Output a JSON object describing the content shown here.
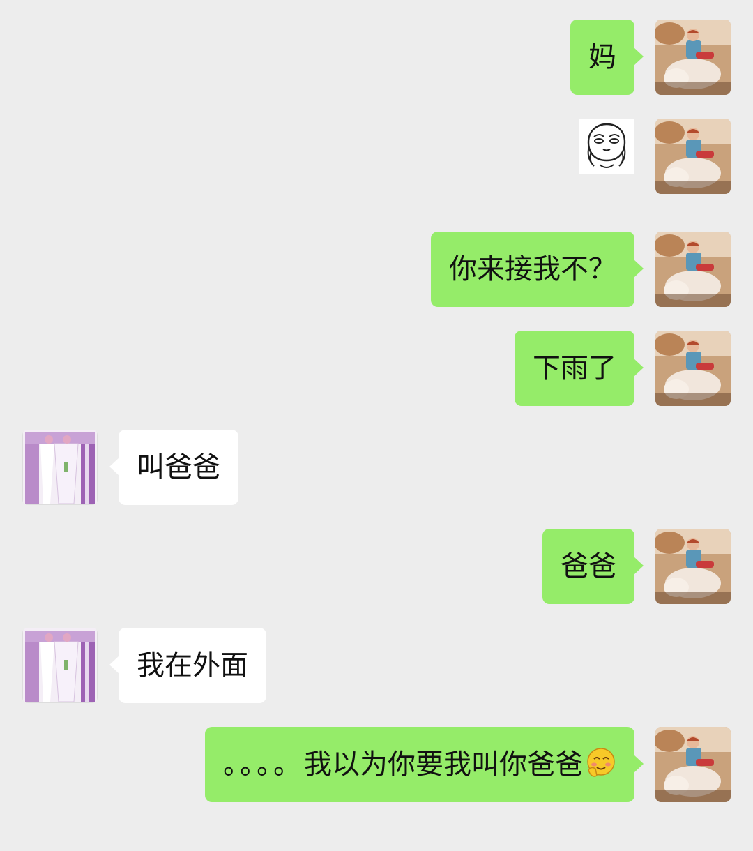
{
  "chat": {
    "messages": [
      {
        "id": "m1",
        "sender": "me",
        "text": "妈"
      },
      {
        "id": "m2",
        "sender": "me",
        "sticker_icon": "shy-face-icon"
      },
      {
        "id": "m3",
        "sender": "me",
        "text": "你来接我不？"
      },
      {
        "id": "m4",
        "sender": "me",
        "text": "下雨了"
      },
      {
        "id": "m5",
        "sender": "them",
        "text": "叫爸爸"
      },
      {
        "id": "m6",
        "sender": "me",
        "text": "爸爸"
      },
      {
        "id": "m7",
        "sender": "them",
        "text": "我在外面"
      },
      {
        "id": "m8",
        "sender": "me",
        "text_dots": "。。。。",
        "text": "我以为你要我叫你爸爸",
        "emoji_icon": "blush-emoji-icon"
      }
    ]
  },
  "colors": {
    "background": "#ededed",
    "my_bubble": "#95ec69",
    "their_bubble": "#ffffff",
    "text": "#111111"
  },
  "icons": {
    "my_avatar": "child-with-dog-avatar",
    "their_avatar": "pink-curtain-avatar"
  }
}
